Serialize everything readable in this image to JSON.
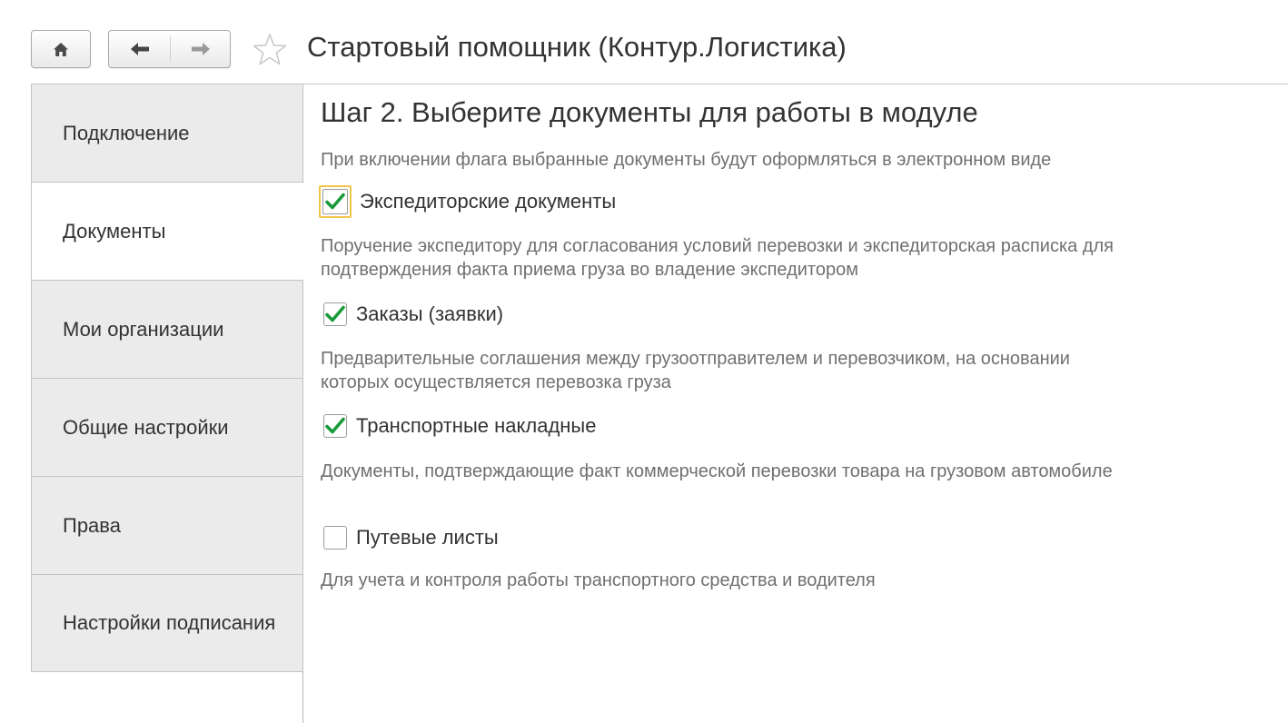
{
  "header": {
    "title": "Стартовый помощник (Контур.Логистика)",
    "home_icon": "home-icon",
    "back_icon": "arrow-left-icon",
    "forward_icon": "arrow-right-icon",
    "favorite_icon": "star-icon"
  },
  "sidebar": {
    "items": [
      {
        "label": "Подключение",
        "active": false
      },
      {
        "label": "Документы",
        "active": true
      },
      {
        "label": "Мои организации",
        "active": false
      },
      {
        "label": "Общие настройки",
        "active": false
      },
      {
        "label": "Права",
        "active": false
      },
      {
        "label": "Настройки подписания",
        "active": false
      }
    ]
  },
  "main": {
    "step_title": "Шаг 2. Выберите документы для работы в модуле",
    "subtitle": "При включении флага выбранные документы будут оформляться в электронном виде",
    "options": [
      {
        "label": "Экспедиторские документы",
        "checked": true,
        "focused": true,
        "description": "Поручение экспедитору для согласования условий перевозки и экспедиторская расписка для подтверждения факта приема груза во владение экспедитором"
      },
      {
        "label": "Заказы (заявки)",
        "checked": true,
        "focused": false,
        "description": "Предварительные соглашения между грузоотправителем и перевозчиком, на основании которых осуществляется перевозка груза"
      },
      {
        "label": "Транспортные накладные",
        "checked": true,
        "focused": false,
        "description": "Документы, подтверждающие факт коммерческой перевозки товара на грузовом автомобиле"
      },
      {
        "label": "Путевые листы",
        "checked": false,
        "focused": false,
        "description": "Для учета и контроля работы транспортного средства и водителя"
      }
    ]
  },
  "colors": {
    "check_mark": "#1a9a3a",
    "focus_border": "#f2c64b",
    "hint_text": "#707070",
    "tab_background": "#ebebeb"
  }
}
